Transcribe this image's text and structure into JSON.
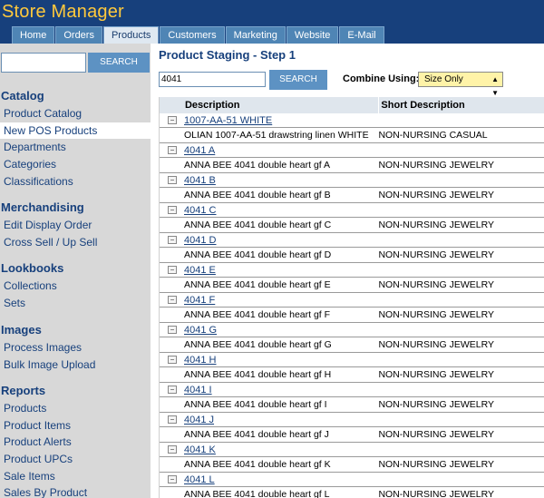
{
  "app": {
    "title": "Store Manager"
  },
  "nav": {
    "tabs": [
      "Home",
      "Orders",
      "Products",
      "Customers",
      "Marketing",
      "Website",
      "E-Mail"
    ]
  },
  "sidebar": {
    "search_button": "SEARCH",
    "groups": [
      {
        "heading": "Catalog",
        "items": [
          "Product Catalog",
          "New POS Products",
          "Departments",
          "Categories",
          "Classifications"
        ]
      },
      {
        "heading": "Merchandising",
        "items": [
          "Edit Display Order",
          "Cross Sell / Up Sell"
        ]
      },
      {
        "heading": "Lookbooks",
        "items": [
          "Collections",
          "Sets"
        ]
      },
      {
        "heading": "Images",
        "items": [
          "Process Images",
          "Bulk Image Upload"
        ]
      },
      {
        "heading": "Reports",
        "items": [
          "Products",
          "Product Items",
          "Product Alerts",
          "Product UPCs",
          "Sale Items",
          "Sales By Product"
        ]
      }
    ]
  },
  "main": {
    "title": "Product Staging - Step 1",
    "search_value": "4041",
    "search_button": "SEARCH",
    "combine_label": "Combine Using:",
    "combine_value": "Size Only",
    "columns": [
      "Description",
      "Short Description"
    ],
    "groups": [
      {
        "link": "1007-AA-51 WHITE",
        "desc": "OLIAN 1007-AA-51 drawstring linen WHITE",
        "short": "NON-NURSING CASUAL"
      },
      {
        "link": "4041 A",
        "desc": "ANNA BEE 4041 double heart gf A",
        "short": "NON-NURSING JEWELRY"
      },
      {
        "link": "4041 B",
        "desc": "ANNA BEE 4041 double heart gf B",
        "short": "NON-NURSING JEWELRY"
      },
      {
        "link": "4041 C",
        "desc": "ANNA BEE 4041 double heart gf C",
        "short": "NON-NURSING JEWELRY"
      },
      {
        "link": "4041 D",
        "desc": "ANNA BEE 4041 double heart gf D",
        "short": "NON-NURSING JEWELRY"
      },
      {
        "link": "4041 E",
        "desc": "ANNA BEE 4041 double heart gf E",
        "short": "NON-NURSING JEWELRY"
      },
      {
        "link": "4041 F",
        "desc": "ANNA BEE 4041 double heart gf F",
        "short": "NON-NURSING JEWELRY"
      },
      {
        "link": "4041 G",
        "desc": "ANNA BEE 4041 double heart gf G",
        "short": "NON-NURSING JEWELRY"
      },
      {
        "link": "4041 H",
        "desc": "ANNA BEE 4041 double heart gf H",
        "short": "NON-NURSING JEWELRY"
      },
      {
        "link": "4041 I",
        "desc": "ANNA BEE 4041 double heart gf I",
        "short": "NON-NURSING JEWELRY"
      },
      {
        "link": "4041 J",
        "desc": "ANNA BEE 4041 double heart gf J",
        "short": "NON-NURSING JEWELRY"
      },
      {
        "link": "4041 K",
        "desc": "ANNA BEE 4041 double heart gf K",
        "short": "NON-NURSING JEWELRY"
      },
      {
        "link": "4041 L",
        "desc": "ANNA BEE 4041 double heart gf L",
        "short": "NON-NURSING JEWELRY"
      }
    ]
  }
}
